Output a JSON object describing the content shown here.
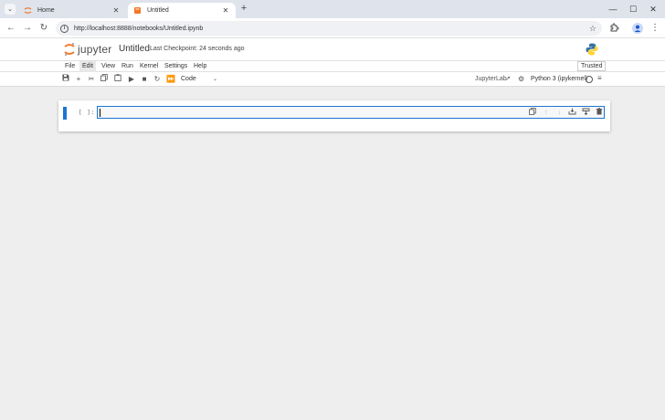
{
  "browser": {
    "tabs": [
      {
        "title": "Home",
        "active": false
      },
      {
        "title": "Untitled",
        "active": true
      }
    ],
    "url": "http://localhost:8888/notebooks/Untitled.ipynb"
  },
  "header": {
    "logo_text": "jupyter",
    "notebook_title": "Untitled",
    "checkpoint": "Last Checkpoint: 24 seconds ago"
  },
  "menu": {
    "items": [
      "File",
      "Edit",
      "View",
      "Run",
      "Kernel",
      "Settings",
      "Help"
    ],
    "active": "Edit",
    "trusted": "Trusted"
  },
  "toolbar": {
    "cell_type": "Code",
    "jupyterlab_link": "JupyterLab",
    "kernel": "Python 3 (ipykernel)"
  },
  "cell": {
    "prompt": "[ ]:",
    "source": ""
  },
  "colors": {
    "accent": "#1976d2",
    "jupyter_orange": "#f37726"
  }
}
